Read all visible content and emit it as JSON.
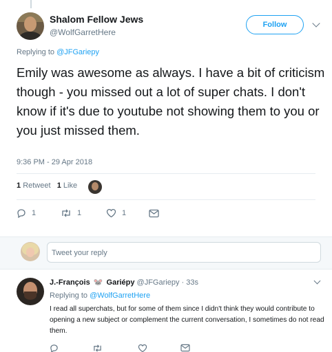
{
  "tweet": {
    "author_name": "Shalom Fellow Jews",
    "author_handle": "@WolfGarretHere",
    "follow_label": "Follow",
    "replying_prefix": "Replying to ",
    "replying_to": "@JFGariepy",
    "text": "Emily was awesome as always. I have a bit of criticism though - you missed out a lot of super chats. I don't know if it's due to youtube not showing them to you or you just missed them.",
    "timestamp": "9:36 PM - 29 Apr 2018",
    "retweet_count": "1",
    "retweet_label": "Retweet",
    "like_count": "1",
    "like_label": "Like"
  },
  "actions": {
    "reply_count": "1",
    "retweet_count": "1",
    "like_count": "1"
  },
  "reply_box": {
    "placeholder": "Tweet your reply"
  },
  "reply": {
    "author_name": "J.-François",
    "author_name_suffix": "Gariépy",
    "emoji": "🐭",
    "author_handle": "@JFGariepy",
    "separator": " · ",
    "time": "33s",
    "replying_prefix": "Replying to ",
    "replying_to": "@WolfGarretHere",
    "text": "I read all superchats, but for some of them since I didn't think they would contribute to opening a new subject or complement the current conversation, I sometimes do not read them."
  },
  "colors": {
    "accent": "#1da1f2",
    "muted": "#657786",
    "text": "#14171a"
  }
}
